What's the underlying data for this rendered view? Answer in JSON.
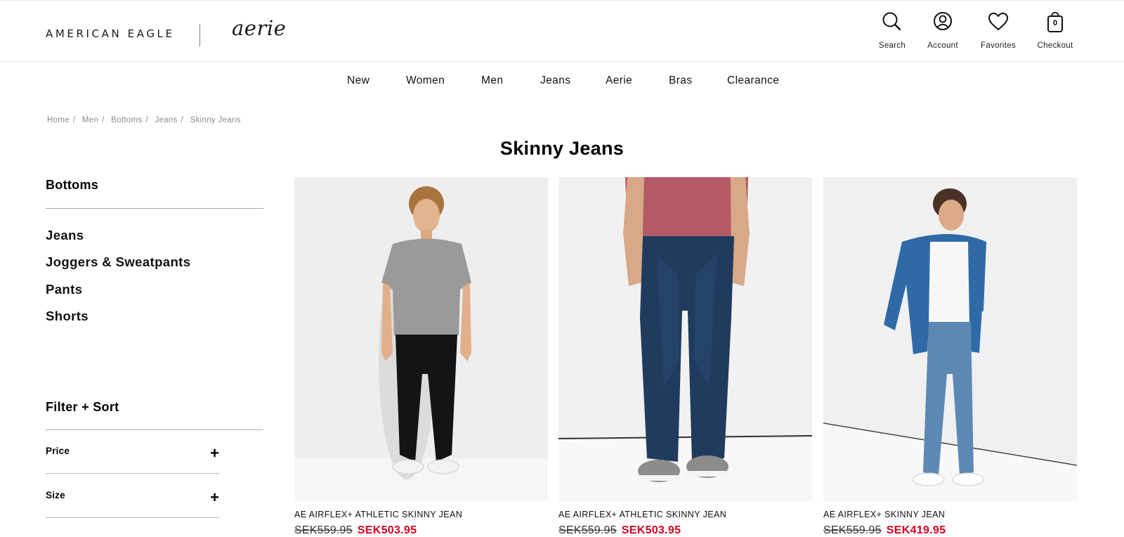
{
  "brand": {
    "primary": "AMERICAN EAGLE",
    "secondary": "aerie"
  },
  "header_actions": [
    {
      "icon": "search-icon",
      "label": "Search"
    },
    {
      "icon": "account-icon",
      "label": "Account"
    },
    {
      "icon": "heart-icon",
      "label": "Favorites"
    },
    {
      "icon": "bag-icon",
      "label": "Checkout",
      "count": "0"
    }
  ],
  "nav": [
    "New",
    "Women",
    "Men",
    "Jeans",
    "Aerie",
    "Bras",
    "Clearance"
  ],
  "breadcrumb": [
    "Home",
    "Men",
    "Bottoms",
    "Jeans",
    "Skinny Jeans"
  ],
  "page_title": "Skinny Jeans",
  "sidebar": {
    "heading": "Bottoms",
    "links": [
      "Jeans",
      "Joggers & Sweatpants",
      "Pants",
      "Shorts"
    ]
  },
  "filters": {
    "heading": "Filter + Sort",
    "facets": [
      {
        "label": "Price",
        "toggle": "+"
      },
      {
        "label": "Size",
        "toggle": "+"
      }
    ]
  },
  "products": [
    {
      "name": "AE AIRFLEX+ ATHLETIC SKINNY JEAN",
      "old_price": "SEK559.95",
      "sale_price": "SEK503.95"
    },
    {
      "name": "AE AIRFLEX+ ATHLETIC SKINNY JEAN",
      "old_price": "SEK559.95",
      "sale_price": "SEK503.95"
    },
    {
      "name": "AE AIRFLEX+ SKINNY JEAN",
      "old_price": "SEK559.95",
      "sale_price": "SEK419.95"
    }
  ],
  "colors": {
    "sale": "#d6001c",
    "text": "#111111",
    "muted": "#8c8c8c"
  }
}
